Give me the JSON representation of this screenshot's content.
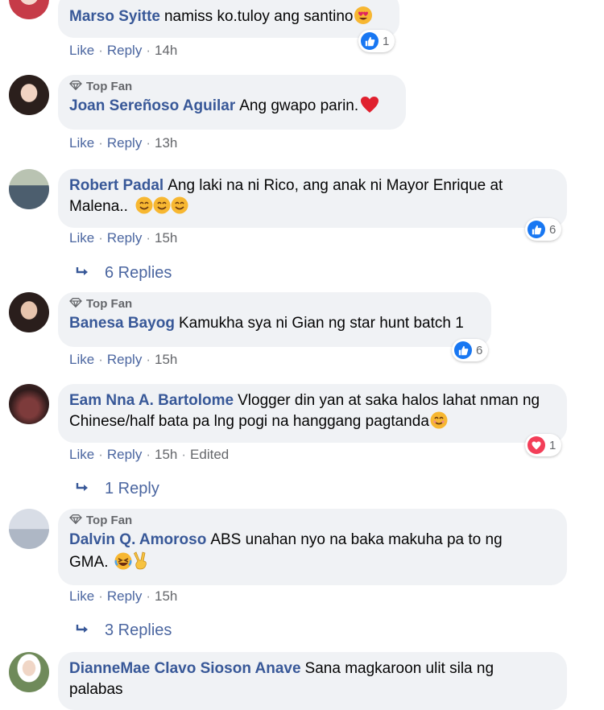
{
  "labels": {
    "like": "Like",
    "reply": "Reply",
    "top_fan": "Top Fan",
    "sep": "·"
  },
  "comments": [
    {
      "author": "Marso Syitte",
      "text": "namiss ko.tuloy ang santino",
      "time": "14h",
      "reaction_count": "1"
    },
    {
      "author": "Joan Sereñoso Aguilar",
      "text": "Ang gwapo parin.",
      "time": "13h"
    },
    {
      "author": "Robert Padal",
      "text": "Ang laki na ni Rico, ang anak ni Mayor Enrique at Malena..",
      "time": "15h",
      "reaction_count": "6",
      "replies": "6 Replies"
    },
    {
      "author": "Banesa Bayog",
      "text": "Kamukha sya ni Gian ng star hunt batch 1",
      "time": "15h",
      "reaction_count": "6"
    },
    {
      "author": "Eam Nna A. Bartolome",
      "text": "Vlogger din yan at saka halos lahat nman ng Chinese/half bata pa lng pogi na hanggang pagtanda",
      "time": "15h",
      "edited": "Edited",
      "reaction_count": "1",
      "replies": "1 Reply"
    },
    {
      "author": "Dalvin Q. Amoroso",
      "text": "ABS unahan nyo na baka makuha pa to ng GMA.",
      "time": "15h",
      "replies": "3 Replies"
    },
    {
      "author": "DianneMae Clavo Sioson Anave",
      "text": "Sana magkaroon ulit sila ng palabas"
    }
  ],
  "colors": {
    "author": "#385898",
    "bubble": "#f0f2f5",
    "like_blue": "#1877f2",
    "love_red": "#f33e58",
    "meta_grey": "#65676b"
  },
  "icons": [
    "top-fan-diamond-icon",
    "like-reaction-icon",
    "love-reaction-icon",
    "reply-arrow-icon",
    "heart-eyes-emoji",
    "red-heart-emoji",
    "smiling-emoji",
    "laughing-emoji",
    "victory-hand-emoji"
  ]
}
